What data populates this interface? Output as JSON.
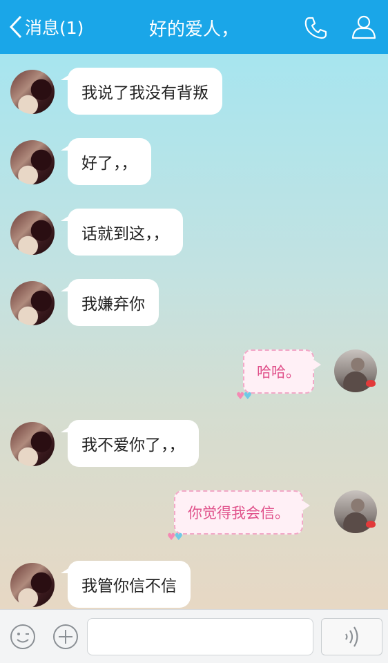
{
  "header": {
    "back_label": "消息(1)",
    "title": "好的爱人，"
  },
  "messages": [
    {
      "side": "left",
      "text": "我说了我没有背叛"
    },
    {
      "side": "left",
      "text": "好了，，"
    },
    {
      "side": "left",
      "text": "话就到这，，"
    },
    {
      "side": "left",
      "text": "我嫌弃你"
    },
    {
      "side": "right",
      "text": "哈哈。"
    },
    {
      "side": "left",
      "text": "我不爱你了，，"
    },
    {
      "side": "right",
      "text": "你觉得我会信。"
    },
    {
      "side": "left",
      "text": "我管你信不信"
    }
  ],
  "input": {
    "value": "",
    "placeholder": ""
  },
  "colors": {
    "header": "#1aa6e8",
    "bubble_left": "#ffffff",
    "bubble_right_text": "#e0508a"
  },
  "icons": [
    "back-chevron-icon",
    "phone-icon",
    "profile-icon",
    "emoji-icon",
    "plus-icon",
    "voice-icon"
  ]
}
